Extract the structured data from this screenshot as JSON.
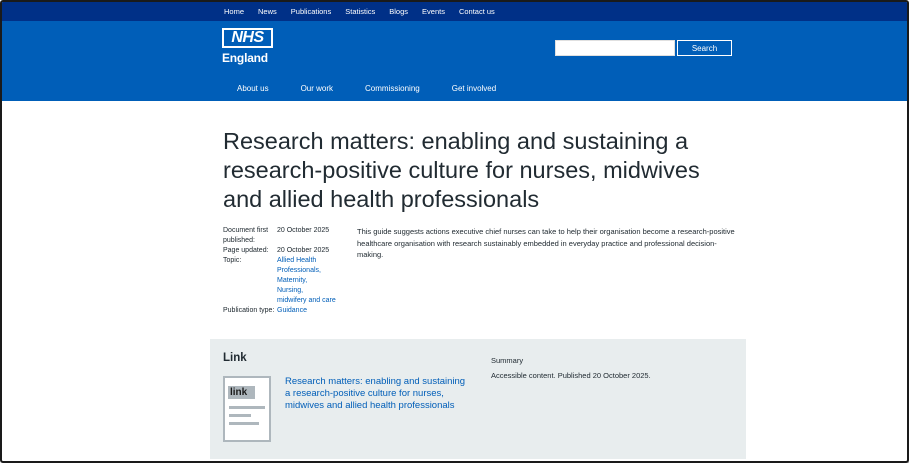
{
  "topnav": {
    "items": [
      "Home",
      "News",
      "Publications",
      "Statistics",
      "Blogs",
      "Events",
      "Contact us"
    ]
  },
  "logo": {
    "mark": "NHS",
    "sub": "England"
  },
  "search": {
    "button_label": "Search",
    "value": ""
  },
  "mainnav": {
    "items": [
      "About us",
      "Our work",
      "Commissioning",
      "Get involved"
    ]
  },
  "page": {
    "title": "Research matters: enabling and sustaining a research-positive culture for nurses, midwives and allied health professionals",
    "summary": "This guide suggests actions executive chief nurses can take to help their organisation become a research-positive healthcare organisation with research sustainably embedded in everyday practice and professional decision-making."
  },
  "meta": {
    "first_published_label": "Document first published:",
    "first_published_value": "20 October 2025",
    "updated_label": "Page updated:",
    "updated_value": "20 October 2025",
    "topic_label": "Topic:",
    "topics": [
      "Allied Health Professionals,",
      "Maternity,",
      "Nursing,",
      "midwifery and care"
    ],
    "type_label": "Publication type:",
    "type_value": "Guidance"
  },
  "link_panel": {
    "heading": "Link",
    "icon_tag": "link",
    "link_text": "Research matters: enabling and sustaining a research-positive culture for nurses, midwives and allied health professionals",
    "summary_label": "Summary",
    "summary_text": "Accessible content. Published 20 October 2025."
  },
  "colors": {
    "nhs_blue": "#005eb8",
    "nhs_dark_blue": "#003087",
    "panel_grey": "#e8edee",
    "text": "#212b32"
  }
}
